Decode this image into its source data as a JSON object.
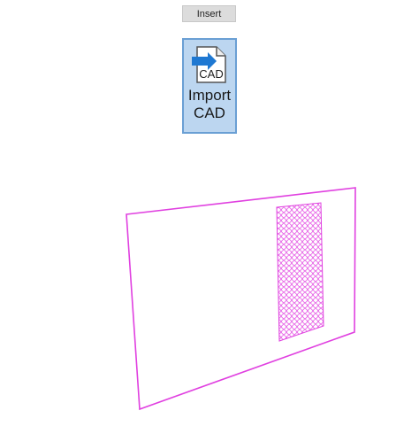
{
  "ribbon": {
    "tab_label": "Insert",
    "import_cad": {
      "line1": "Import",
      "line2": "CAD",
      "icon": "import-cad-icon",
      "icon_text": "CAD"
    }
  },
  "colors": {
    "geometry": "#e040e0",
    "button_bg": "#bcd6f0",
    "button_border": "#6a9fd4",
    "arrow": "#1e78d2"
  }
}
